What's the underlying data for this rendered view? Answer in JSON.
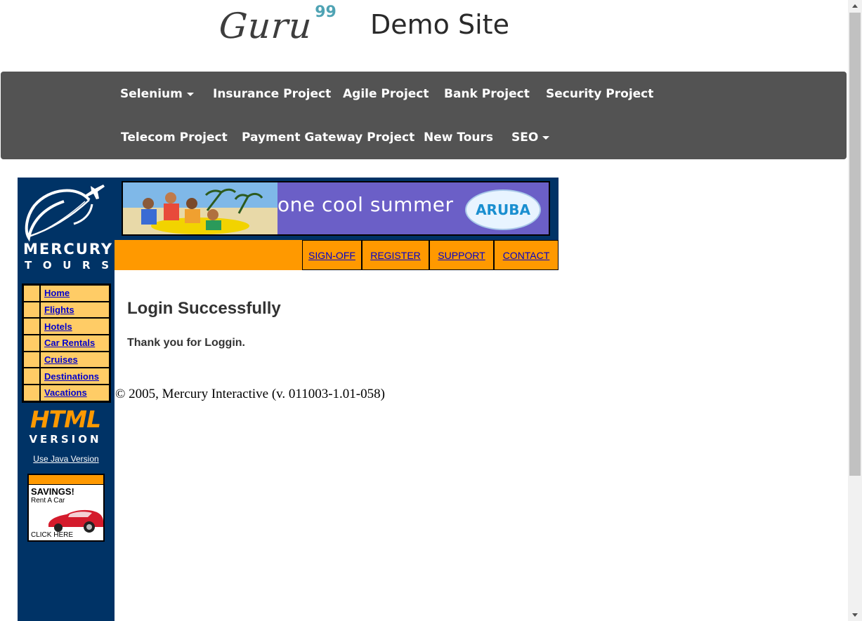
{
  "header": {
    "logo_text": "Guru",
    "logo_superscript": "99",
    "site_title": "Demo Site"
  },
  "nav": {
    "row1": [
      {
        "label": "Selenium",
        "dropdown": true
      },
      {
        "label": "Insurance Project",
        "dropdown": false
      },
      {
        "label": "Agile Project",
        "dropdown": false
      },
      {
        "label": "Bank Project",
        "dropdown": false
      },
      {
        "label": "Security Project",
        "dropdown": false
      }
    ],
    "row2": [
      {
        "label": "Telecom Project",
        "dropdown": false
      },
      {
        "label": "Payment Gateway Project",
        "dropdown": false
      },
      {
        "label": "New Tours",
        "dropdown": false
      },
      {
        "label": "SEO",
        "dropdown": true
      }
    ]
  },
  "mercury": {
    "logo_word1": "MERCURY",
    "logo_word2": [
      "T",
      "O",
      "U",
      "R",
      "S"
    ],
    "side_menu": [
      "Home",
      "Flights",
      "Hotels",
      "Car Rentals",
      "Cruises",
      "Destinations",
      "Vacations"
    ],
    "html_badge": "HTML",
    "version_badge": "VERSION",
    "java_link": "Use Java Version",
    "ad": {
      "title": "SAVINGS!",
      "subtitle": "Rent A Car",
      "cta": "CLICK HERE"
    }
  },
  "banner": {
    "text": "one cool summer",
    "brand": "ARUBA"
  },
  "top_links": [
    "SIGN-OFF",
    "REGISTER",
    "SUPPORT",
    "CONTACT"
  ],
  "content": {
    "heading": "Login Successfully",
    "message": "Thank you for Loggin.",
    "copyright": "© 2005, Mercury Interactive (v. 011003-1.01-058)"
  },
  "colors": {
    "navbar": "#535353",
    "mercury_blue": "#003366",
    "orange": "#ff9900",
    "menu_cell": "#ffcc66",
    "link": "#0000cc"
  }
}
